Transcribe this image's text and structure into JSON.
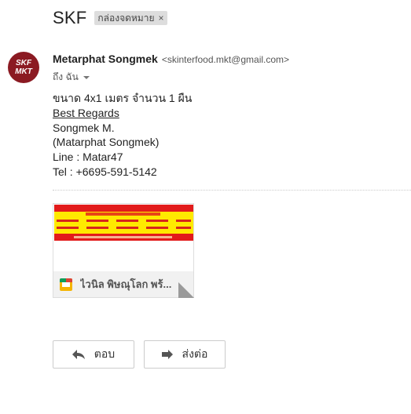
{
  "subject": "SKF",
  "label_chip": "กล่องจดหมาย",
  "label_chip_close": "×",
  "avatar": {
    "line1": "SKF",
    "line2": "MKT",
    "color": "#8b1a22"
  },
  "sender": {
    "name": "Metarphat Songmek",
    "email": "<skinterfood.mkt@gmail.com>"
  },
  "to_line": "ถึง ฉัน",
  "body_lines": [
    "ขนาด 4x1 เมตร จำนวน 1 ผืน",
    "Best Regards",
    "Songmek M.",
    "(Matarphat Songmek)",
    "Line : Matar47",
    "Tel : +6695-591-5142"
  ],
  "attachment": {
    "name": "ไวนิล พิษณุโลก พร้...",
    "icon": "google-slides-icon"
  },
  "buttons": {
    "reply": "ตอบ",
    "forward": "ส่งต่อ"
  }
}
